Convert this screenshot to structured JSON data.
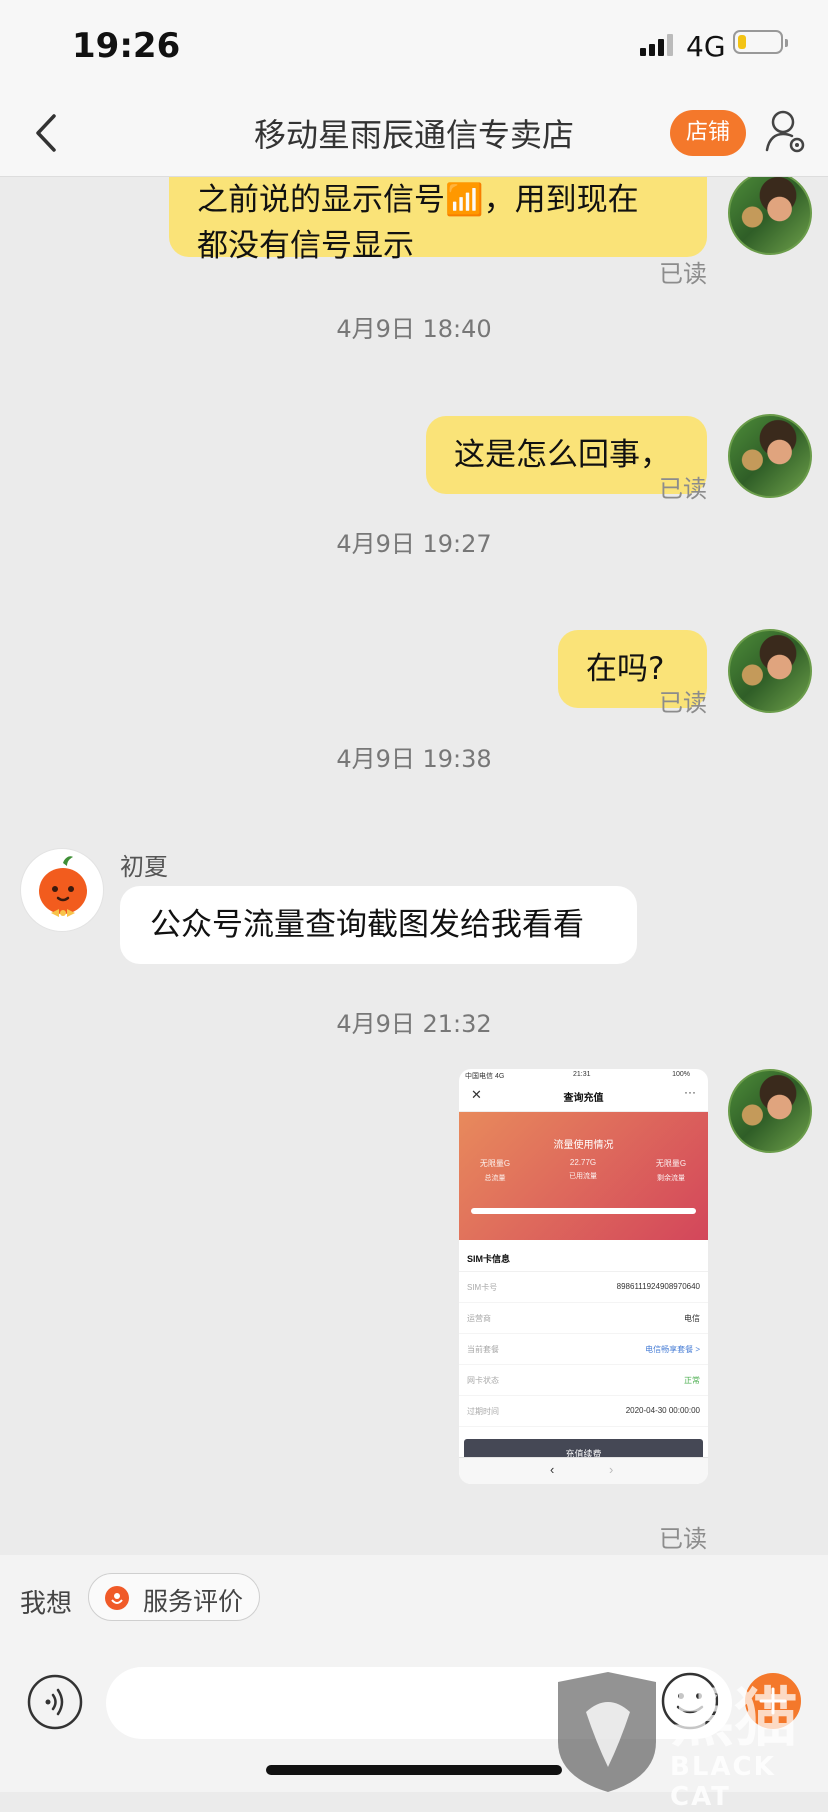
{
  "status_bar": {
    "time": "19:26",
    "network": "4G"
  },
  "header": {
    "title": "移动星雨辰通信专卖店",
    "shop_button": "店铺"
  },
  "messages": [
    {
      "sender": "me",
      "lines": [
        "之前说的显示信号📶，用到现在",
        "都没有信号显示"
      ],
      "read": "已读"
    },
    {
      "timestamp": "4月9日 18:40"
    },
    {
      "sender": "me",
      "text": "这是怎么回事，",
      "read": "已读"
    },
    {
      "timestamp": "4月9日 19:27"
    },
    {
      "sender": "me",
      "text": "在吗?",
      "read": "已读"
    },
    {
      "timestamp": "4月9日 19:38"
    },
    {
      "sender": "agent",
      "name": "初夏",
      "text": "公众号流量查询截图发给我看看"
    },
    {
      "timestamp": "4月9日 21:32"
    },
    {
      "sender": "me",
      "type": "image",
      "read": "已读"
    }
  ],
  "screenshot": {
    "status_left": "中国电信 4G",
    "status_time": "21:31",
    "status_right": "100%",
    "title": "查询充值",
    "usage_title": "流量使用情况",
    "stats": [
      {
        "value": "无限量G",
        "label": "总流量"
      },
      {
        "value": "22.77G",
        "label": "已用流量"
      },
      {
        "value": "无限量G",
        "label": "剩余流量"
      }
    ],
    "section": "SIM卡信息",
    "rows": [
      {
        "key": "SIM卡号",
        "value": "8986111924908970640"
      },
      {
        "key": "运营商",
        "value": "电信"
      },
      {
        "key": "当前套餐",
        "value": "电信畅享套餐 >"
      },
      {
        "key": "网卡状态",
        "value": "正常"
      },
      {
        "key": "过期时间",
        "value": "2020-04-30 00:00:00"
      }
    ],
    "pay_button": "充值续费",
    "colors": {
      "gradient_start": "#e88a5c",
      "gradient_end": "#d3465b",
      "link": "#4a7fd6",
      "status_ok": "#4caf50"
    }
  },
  "suggest": {
    "label": "我想",
    "chip": "服务评价"
  },
  "watermark": {
    "text": "BLACK CAT"
  },
  "colors": {
    "accent": "#f4782b",
    "my_bubble": "#fae378",
    "background": "#ebebeb"
  }
}
